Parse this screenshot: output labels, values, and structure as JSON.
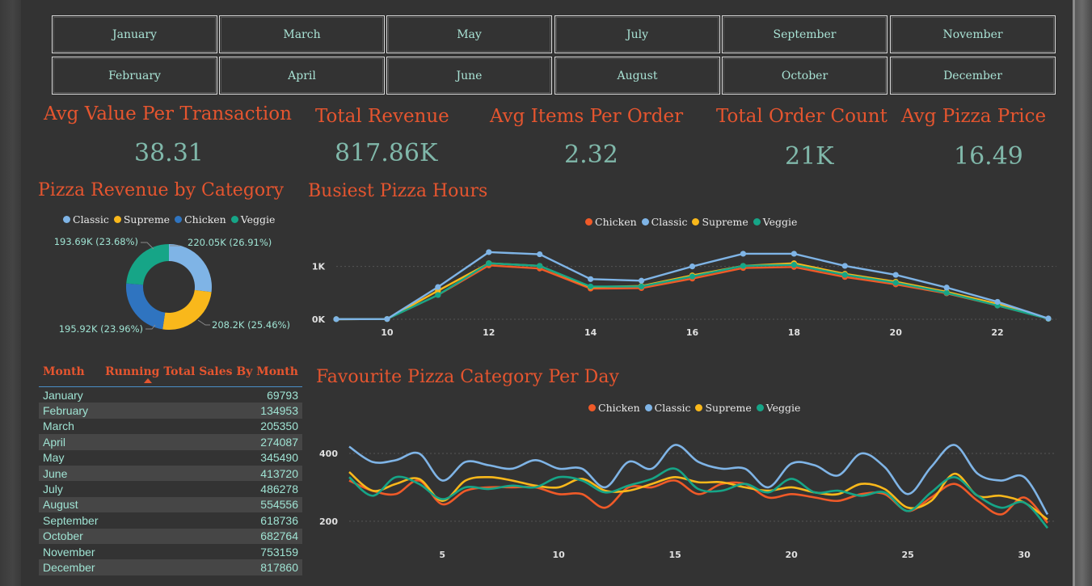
{
  "months_slicer": {
    "row1": [
      "January",
      "March",
      "May",
      "July",
      "September",
      "November"
    ],
    "row2": [
      "February",
      "April",
      "June",
      "August",
      "October",
      "December"
    ]
  },
  "kpis": [
    {
      "title": "Avg Value Per Transaction",
      "value": "38.31"
    },
    {
      "title": "Total Revenue",
      "value": "817.86K"
    },
    {
      "title": "Avg Items Per Order",
      "value": "2.32"
    },
    {
      "title": "Total Order Count",
      "value": "21K"
    },
    {
      "title": "Avg Pizza Price",
      "value": "16.49"
    }
  ],
  "colors": {
    "accent": "#e5552f",
    "kpi_value": "#80b8aa",
    "Chicken": "#f05a28",
    "Classic": "#7fb4e6",
    "Supreme": "#f9b81b",
    "Veggie": "#16a587",
    "Chicken_donut": "#2f74c0"
  },
  "donut": {
    "title": "Pizza Revenue by Category",
    "legend": [
      "Classic",
      "Supreme",
      "Chicken",
      "Veggie"
    ],
    "labels": [
      "220.05K (26.91%)",
      "208.2K (25.46%)",
      "195.92K (23.96%)",
      "193.69K (23.68%)"
    ]
  },
  "hours": {
    "title": "Busiest Pizza Hours",
    "legend": [
      "Chicken",
      "Classic",
      "Supreme",
      "Veggie"
    ],
    "y_ticks": [
      "1K",
      "0K"
    ],
    "x_ticks": [
      "10",
      "12",
      "14",
      "16",
      "18",
      "20",
      "22"
    ]
  },
  "days": {
    "title": "Favourite Pizza Category Per Day",
    "legend": [
      "Chicken",
      "Classic",
      "Supreme",
      "Veggie"
    ],
    "y_ticks": [
      "400",
      "200"
    ],
    "x_ticks": [
      "5",
      "10",
      "15",
      "20",
      "25",
      "30"
    ]
  },
  "table": {
    "col_month": "Month",
    "col_total": "Running Total Sales By Month",
    "rows": [
      [
        "January",
        "69793"
      ],
      [
        "February",
        "134953"
      ],
      [
        "March",
        "205350"
      ],
      [
        "April",
        "274087"
      ],
      [
        "May",
        "345490"
      ],
      [
        "June",
        "413720"
      ],
      [
        "July",
        "486278"
      ],
      [
        "August",
        "554556"
      ],
      [
        "September",
        "618736"
      ],
      [
        "October",
        "682764"
      ],
      [
        "November",
        "753159"
      ],
      [
        "December",
        "817860"
      ]
    ]
  },
  "chart_data": [
    {
      "type": "pie",
      "title": "Pizza Revenue by Category",
      "categories": [
        "Classic",
        "Supreme",
        "Chicken",
        "Veggie"
      ],
      "values": [
        220.05,
        208.2,
        195.92,
        193.69
      ],
      "percent": [
        26.91,
        25.46,
        23.96,
        23.68
      ]
    },
    {
      "type": "line",
      "title": "Busiest Pizza Hours",
      "x": [
        9,
        10,
        11,
        12,
        13,
        14,
        15,
        16,
        17,
        18,
        19,
        20,
        21,
        22,
        23
      ],
      "ylim": [
        0,
        1200
      ],
      "series": [
        {
          "name": "Chicken",
          "values": [
            2,
            5,
            460,
            1020,
            960,
            580,
            590,
            770,
            970,
            990,
            800,
            660,
            490,
            260,
            10
          ]
        },
        {
          "name": "Classic",
          "values": [
            2,
            5,
            610,
            1270,
            1230,
            760,
            730,
            1000,
            1240,
            1240,
            1010,
            840,
            600,
            330,
            15
          ]
        },
        {
          "name": "Supreme",
          "values": [
            2,
            5,
            540,
            1060,
            1010,
            610,
            630,
            830,
            1010,
            1060,
            860,
            710,
            520,
            290,
            10
          ]
        },
        {
          "name": "Veggie",
          "values": [
            2,
            5,
            460,
            1060,
            1010,
            620,
            620,
            810,
            1010,
            1030,
            840,
            690,
            500,
            260,
            10
          ]
        }
      ]
    },
    {
      "type": "line",
      "title": "Favourite Pizza Category Per Day",
      "x": [
        1,
        2,
        3,
        4,
        5,
        6,
        7,
        8,
        9,
        10,
        11,
        12,
        13,
        14,
        15,
        16,
        17,
        18,
        19,
        20,
        21,
        22,
        23,
        24,
        25,
        26,
        27,
        28,
        29,
        30,
        31
      ],
      "ylim": [
        150,
        450
      ],
      "series": [
        {
          "name": "Chicken",
          "values": [
            320,
            290,
            280,
            320,
            250,
            290,
            300,
            300,
            300,
            280,
            280,
            240,
            300,
            300,
            320,
            280,
            310,
            310,
            270,
            280,
            270,
            260,
            280,
            280,
            230,
            270,
            310,
            260,
            220,
            270,
            195
          ]
        },
        {
          "name": "Classic",
          "values": [
            420,
            375,
            380,
            400,
            320,
            375,
            365,
            355,
            380,
            355,
            355,
            300,
            375,
            355,
            425,
            375,
            355,
            355,
            300,
            370,
            365,
            335,
            400,
            360,
            280,
            360,
            425,
            340,
            320,
            330,
            220
          ]
        },
        {
          "name": "Supreme",
          "values": [
            345,
            290,
            310,
            325,
            260,
            320,
            330,
            320,
            305,
            300,
            325,
            290,
            290,
            310,
            330,
            315,
            315,
            300,
            290,
            300,
            285,
            280,
            310,
            295,
            240,
            260,
            340,
            275,
            275,
            255,
            205
          ]
        },
        {
          "name": "Veggie",
          "values": [
            330,
            275,
            330,
            310,
            265,
            300,
            295,
            305,
            300,
            330,
            320,
            285,
            305,
            325,
            355,
            295,
            290,
            310,
            285,
            325,
            285,
            290,
            275,
            285,
            230,
            285,
            330,
            275,
            240,
            255,
            180
          ]
        }
      ]
    }
  ]
}
